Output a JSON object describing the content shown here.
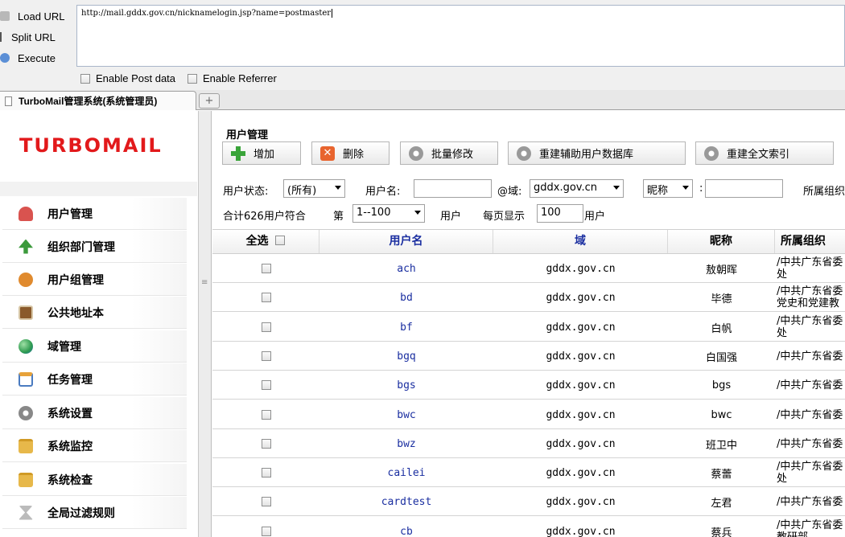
{
  "hackbar": {
    "buttons": [
      "Load URL",
      "Split URL",
      "Execute"
    ],
    "url": "http://mail.gddx.gov.cn/nicknamelogin.jsp?name=postmaster",
    "options": [
      "Enable Post data",
      "Enable Referrer"
    ]
  },
  "browser": {
    "tab_title": "TurboMail管理系统(系统管理员)",
    "new_tab": "+"
  },
  "sidebar": {
    "logo": "TURBOMAIL",
    "items": [
      {
        "label": "用户管理",
        "icon": "user-icon",
        "color": "#d9534f"
      },
      {
        "label": "组织部门管理",
        "icon": "org-tree-icon",
        "color": "#3c9a3c"
      },
      {
        "label": "用户组管理",
        "icon": "user-group-icon",
        "color": "#e08a2e"
      },
      {
        "label": "公共地址本",
        "icon": "address-book-icon",
        "color": "#8a5a2b"
      },
      {
        "label": "域管理",
        "icon": "globe-icon",
        "color": "#2e9a4f"
      },
      {
        "label": "任务管理",
        "icon": "task-icon",
        "color": "#4a7bc0"
      },
      {
        "label": "系统设置",
        "icon": "gear-icon",
        "color": "#888888"
      },
      {
        "label": "系统监控",
        "icon": "folder-monitor-icon",
        "color": "#e7b84a"
      },
      {
        "label": "系统检查",
        "icon": "folder-check-icon",
        "color": "#e7b84a"
      },
      {
        "label": "全局过滤规则",
        "icon": "hourglass-icon",
        "color": "#999999"
      }
    ]
  },
  "main": {
    "title": "用户管理",
    "toolbar": {
      "add": "增加",
      "delete": "删除",
      "batch_edit": "批量修改",
      "rebuild_aux": "重建辅助用户数据库",
      "rebuild_index": "重建全文索引"
    },
    "filters": {
      "status_label": "用户状态:",
      "status_value": "(所有)",
      "username_label": "用户名:",
      "username_value": "",
      "domain_label": "@域:",
      "domain_value": "gddx.gov.cn",
      "nick_select": "昵称",
      "colon": ":",
      "nick_value": "",
      "org_label": "所属组织"
    },
    "summary": {
      "total": "合计626用户符合",
      "page_prefix": "第",
      "page_range": "1--100",
      "page_suffix": "用户",
      "per_page_label": "每页显示",
      "per_page_value": "100",
      "per_page_suffix": "用户"
    },
    "table": {
      "headers": {
        "select_all": "全选",
        "username": "用户名",
        "domain": "域",
        "nickname": "昵称",
        "org": "所属组织"
      },
      "rows": [
        {
          "user": "ach",
          "domain": "gddx.gov.cn",
          "nick": "敖朝晖",
          "org": "/中共广东省委\n处"
        },
        {
          "user": "bd",
          "domain": "gddx.gov.cn",
          "nick": "毕德",
          "org": "/中共广东省委\n党史和党建教"
        },
        {
          "user": "bf",
          "domain": "gddx.gov.cn",
          "nick": "白帆",
          "org": "/中共广东省委\n处"
        },
        {
          "user": "bgq",
          "domain": "gddx.gov.cn",
          "nick": "白国强",
          "org": "/中共广东省委"
        },
        {
          "user": "bgs",
          "domain": "gddx.gov.cn",
          "nick": "bgs",
          "org": "/中共广东省委"
        },
        {
          "user": "bwc",
          "domain": "gddx.gov.cn",
          "nick": "bwc",
          "org": "/中共广东省委"
        },
        {
          "user": "bwz",
          "domain": "gddx.gov.cn",
          "nick": "班卫中",
          "org": "/中共广东省委"
        },
        {
          "user": "cailei",
          "domain": "gddx.gov.cn",
          "nick": "蔡蕾",
          "org": "/中共广东省委\n处"
        },
        {
          "user": "cardtest",
          "domain": "gddx.gov.cn",
          "nick": "左君",
          "org": "/中共广东省委"
        },
        {
          "user": "cb",
          "domain": "gddx.gov.cn",
          "nick": "蔡兵",
          "org": "/中共广东省委\n教研部"
        }
      ]
    }
  }
}
